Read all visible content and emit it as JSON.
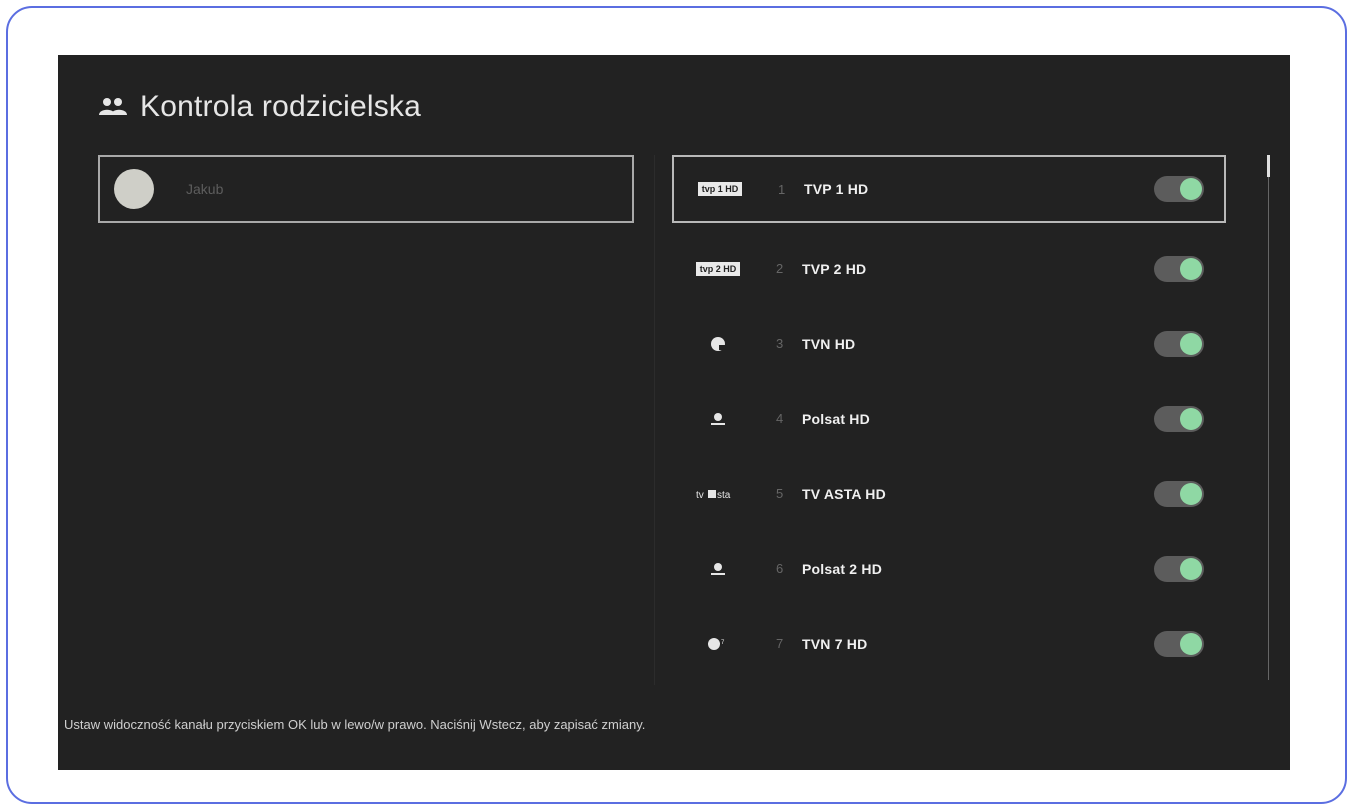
{
  "header": {
    "icon": "people-icon",
    "title": "Kontrola rodzicielska"
  },
  "profile": {
    "name": "Jakub"
  },
  "channels": [
    {
      "logo": "tvp1-logo",
      "number": "1",
      "name": "TVP 1 HD",
      "enabled": true
    },
    {
      "logo": "tvp2-logo",
      "number": "2",
      "name": "TVP 2 HD",
      "enabled": true
    },
    {
      "logo": "tvn-logo",
      "number": "3",
      "name": "TVN HD",
      "enabled": true
    },
    {
      "logo": "polsat-logo",
      "number": "4",
      "name": "Polsat HD",
      "enabled": true
    },
    {
      "logo": "tvasta-logo",
      "number": "5",
      "name": "TV ASTA HD",
      "enabled": true
    },
    {
      "logo": "polsat2-logo",
      "number": "6",
      "name": "Polsat 2 HD",
      "enabled": true
    },
    {
      "logo": "tvn7-logo",
      "number": "7",
      "name": "TVN 7 HD",
      "enabled": true
    }
  ],
  "footer": {
    "hint": "Ustaw widoczność kanału przyciskiem OK lub w lewo/w prawo. Naciśnij Wstecz, aby zapisać zmiany."
  },
  "colors": {
    "background": "#222222",
    "toggle_on": "#8fd8a4",
    "frame": "#5b6ee1"
  }
}
